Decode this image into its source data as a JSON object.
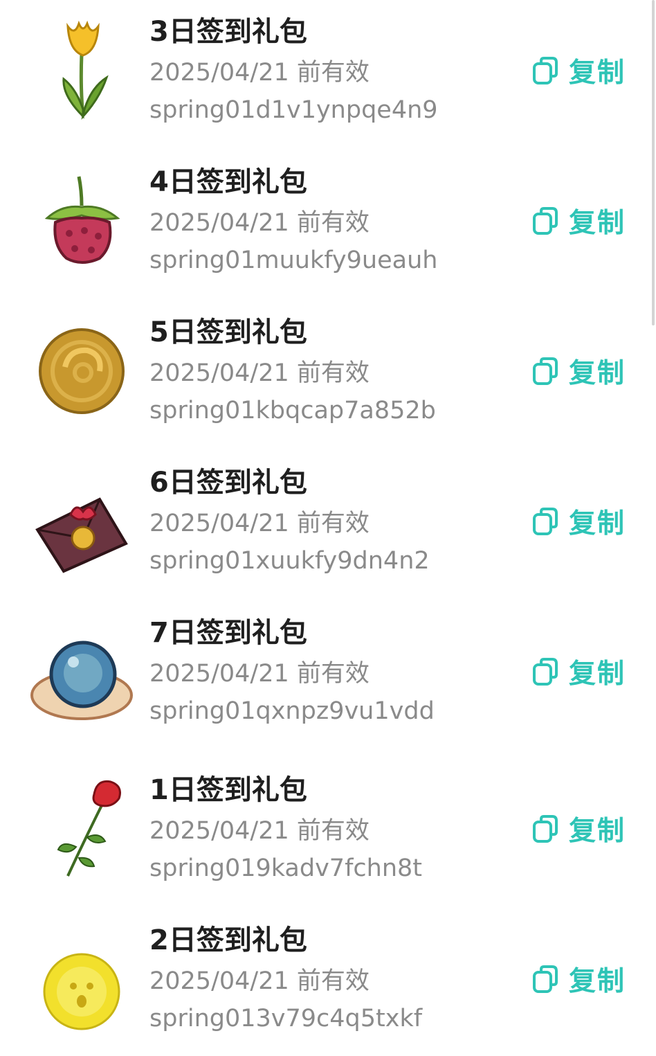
{
  "colors": {
    "accent": "#2ec4b6",
    "title": "#1f1f1f",
    "secondary": "#8a8a8a"
  },
  "gifts": [
    {
      "title": "3日签到礼包",
      "expiry": "2025/04/21 前有效",
      "code": "spring01d1v1ynpqe4n9",
      "copy_label": "复制",
      "icon": "tulip-icon"
    },
    {
      "title": "4日签到礼包",
      "expiry": "2025/04/21 前有效",
      "code": "spring01muukfy9ueauh",
      "copy_label": "复制",
      "icon": "raspberry-icon"
    },
    {
      "title": "5日签到礼包",
      "expiry": "2025/04/21 前有效",
      "code": "spring01kbqcap7a852b",
      "copy_label": "复制",
      "icon": "gold-coin-icon"
    },
    {
      "title": "6日签到礼包",
      "expiry": "2025/04/21 前有效",
      "code": "spring01xuukfy9dn4n2",
      "copy_label": "复制",
      "icon": "envelope-icon"
    },
    {
      "title": "7日签到礼包",
      "expiry": "2025/04/21 前有效",
      "code": "spring01qxnpz9vu1vdd",
      "copy_label": "复制",
      "icon": "crystal-ball-icon"
    },
    {
      "title": "1日签到礼包",
      "expiry": "2025/04/21 前有效",
      "code": "spring019kadv7fchn8t",
      "copy_label": "复制",
      "icon": "rose-icon"
    },
    {
      "title": "2日签到礼包",
      "expiry": "2025/04/21 前有效",
      "code": "spring013v79c4q5txkf",
      "copy_label": "复制",
      "icon": "yellow-coin-icon"
    }
  ]
}
